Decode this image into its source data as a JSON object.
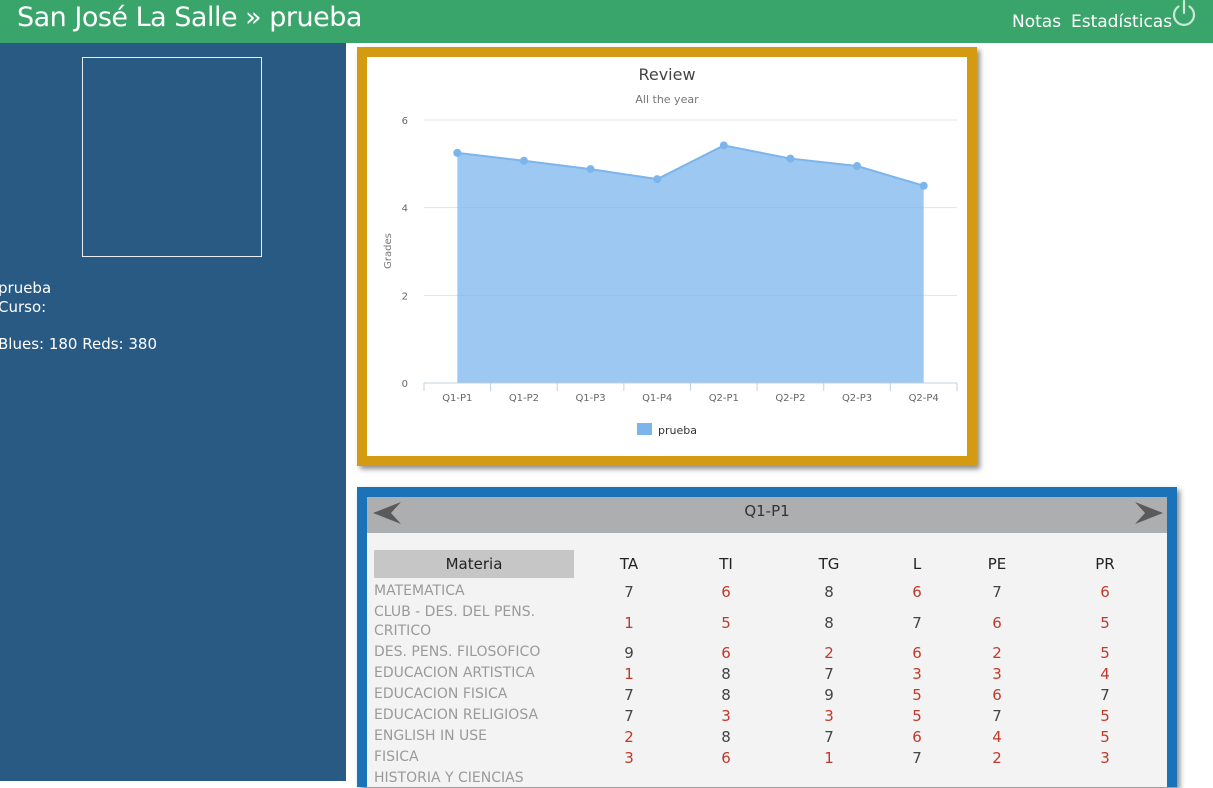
{
  "header": {
    "brand": "San José La Salle » prueba",
    "nav": [
      {
        "label": "Notas"
      },
      {
        "label": "Estadísticas"
      }
    ],
    "power_icon": "power-icon"
  },
  "sidebar": {
    "name_line": "prueba",
    "curso_line": "Curso:",
    "counts_line": "Blues: 180 Reds: 380"
  },
  "chart_data": {
    "type": "area",
    "title": "Review",
    "subtitle": "All the year",
    "ylabel": "Grades",
    "xlabel": "",
    "categories": [
      "Q1-P1",
      "Q1-P2",
      "Q1-P3",
      "Q1-P4",
      "Q2-P1",
      "Q2-P2",
      "Q2-P3",
      "Q2-P4"
    ],
    "series": [
      {
        "name": "prueba",
        "values": [
          5.25,
          5.07,
          4.88,
          4.65,
          5.42,
          5.12,
          4.95,
          4.5
        ],
        "color": "#7cb5ec"
      }
    ],
    "ylim": [
      0,
      6
    ],
    "yticks": [
      0,
      2,
      4,
      6
    ],
    "grid": true,
    "legend": "bottom-center"
  },
  "grades": {
    "period": "Q1-P1",
    "prev_icon": "arrow-left-icon",
    "next_icon": "arrow-right-icon",
    "columns": [
      "Materia",
      "TA",
      "TI",
      "TG",
      "L",
      "PE",
      "PR"
    ],
    "rows": [
      {
        "subject": "MATEMATICA",
        "values": [
          "7",
          "6",
          "8",
          "6",
          "7",
          "6"
        ]
      },
      {
        "subject": "CLUB - DES. DEL PENS. CRITICO",
        "values": [
          "1",
          "5",
          "8",
          "7",
          "6",
          "5"
        ]
      },
      {
        "subject": "DES. PENS. FILOSOFICO",
        "values": [
          "9",
          "6",
          "2",
          "6",
          "2",
          "5"
        ]
      },
      {
        "subject": "EDUCACION ARTISTICA",
        "values": [
          "1",
          "8",
          "7",
          "3",
          "3",
          "4"
        ]
      },
      {
        "subject": "EDUCACION FISICA",
        "values": [
          "7",
          "8",
          "9",
          "5",
          "6",
          "7"
        ]
      },
      {
        "subject": "EDUCACION RELIGIOSA",
        "values": [
          "7",
          "3",
          "3",
          "5",
          "7",
          "5"
        ]
      },
      {
        "subject": "ENGLISH IN USE",
        "values": [
          "2",
          "8",
          "7",
          "6",
          "4",
          "5"
        ]
      },
      {
        "subject": "FISICA",
        "values": [
          "3",
          "6",
          "1",
          "7",
          "2",
          "3"
        ]
      },
      {
        "subject": "HISTORIA Y CIENCIAS",
        "values": []
      }
    ]
  }
}
